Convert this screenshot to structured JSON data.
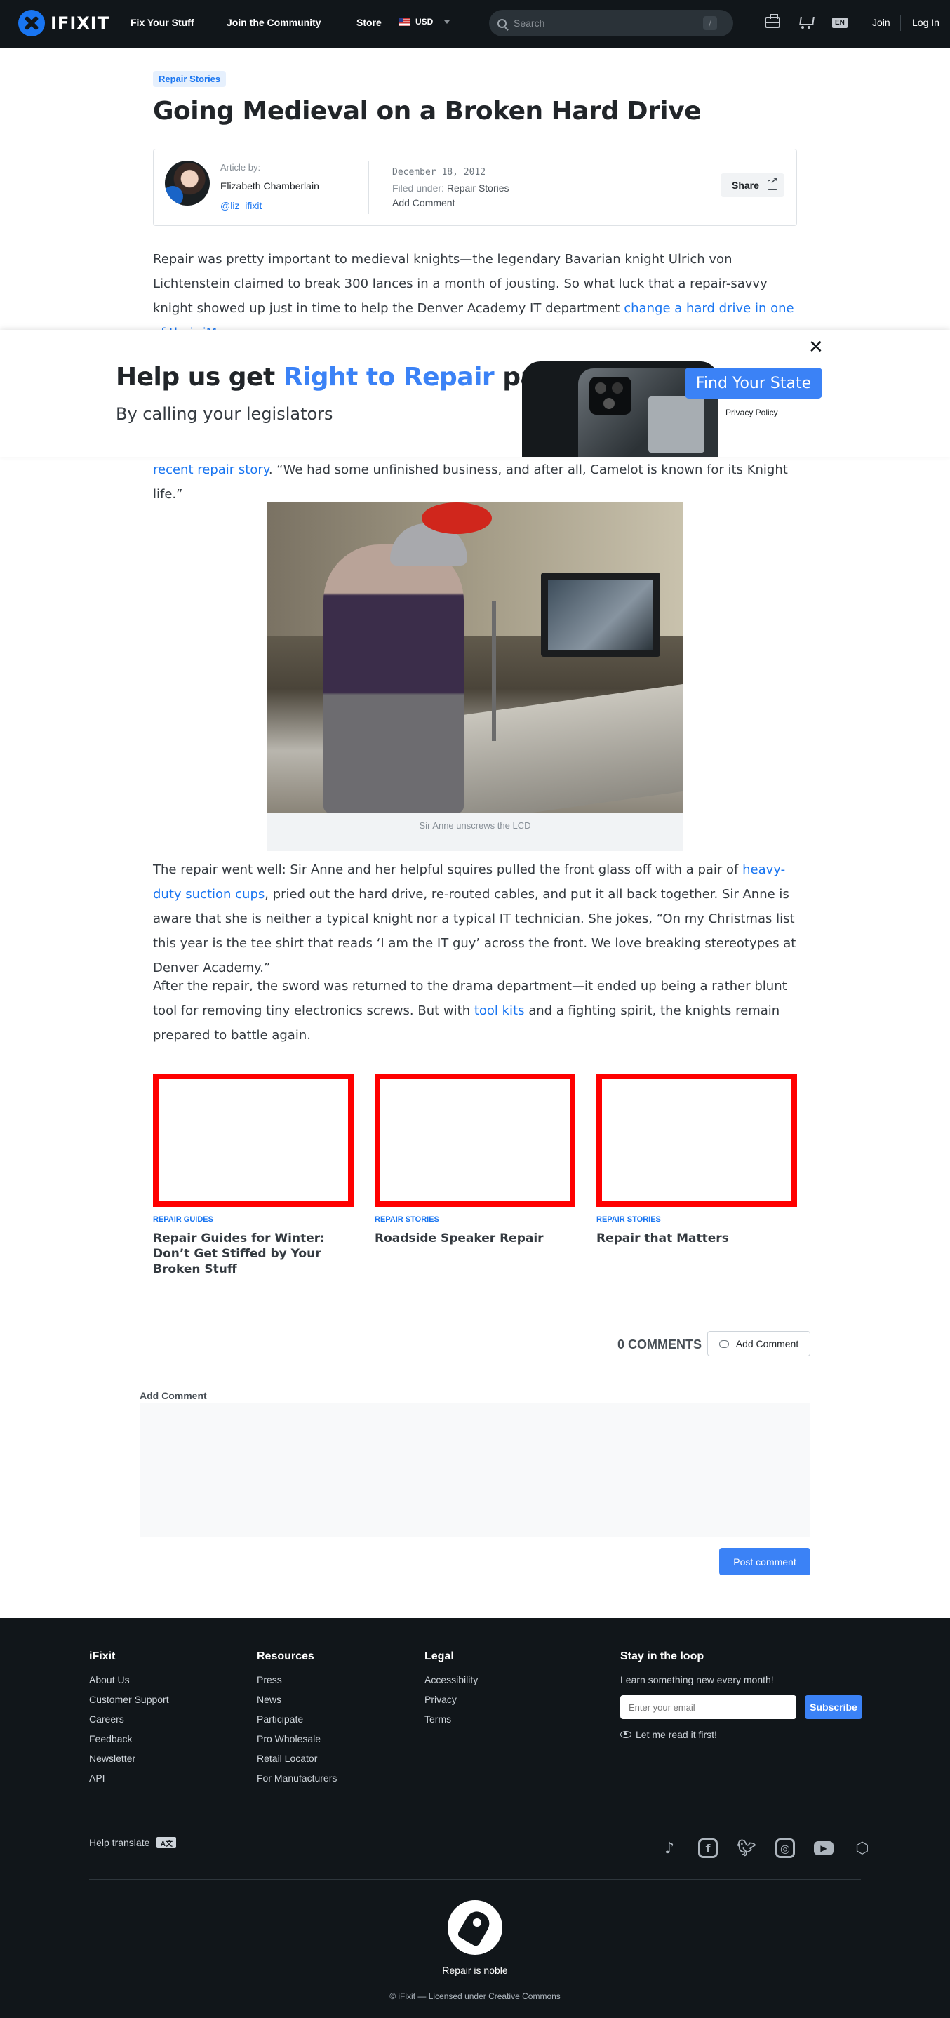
{
  "nav": {
    "logo_text": "IFIXIT",
    "links": [
      "Fix Your Stuff",
      "Join the Community",
      "Store"
    ],
    "currency": "USD",
    "search_placeholder": "Search",
    "search_shortcut": "/",
    "lang": "EN",
    "join": "Join",
    "login": "Log In"
  },
  "article": {
    "tag": "Repair Stories",
    "title": "Going Medieval on a Broken Hard Drive",
    "byline": {
      "label": "Article by:",
      "author": "Elizabeth Chamberlain",
      "handle": "@liz_ifixit",
      "date": "December 18, 2012",
      "filed_prefix": "Filed under:",
      "filed_value": "Repair Stories",
      "add_comment": "Add Comment",
      "share": "Share"
    },
    "p1_text": "Repair was pretty important to medieval knights—the legendary Bavarian knight Ulrich von Lichtenstein claimed to break 300 lances in a month of jousting. So what luck that a repair-savvy knight showed up just in time to help the Denver Academy IT department ",
    "p1_link": "change a hard drive in one of their iMacs",
    "p1_end": ".",
    "p2_link": "recent repair story",
    "p2_text": ". “We had some unfinished business, and after all, Camelot is known for its Knight life.”",
    "caption": "Sir Anne unscrews the LCD",
    "p3_text_a": "The repair went well: Sir Anne and her helpful squires pulled the front glass off with a pair of ",
    "p3_link": "heavy-duty suction cups",
    "p3_text_b": ", pried out the hard drive, re-routed cables, and put it all back together. Sir Anne is aware that she is neither a typical knight nor a typical IT technician. She jokes, “On my Christmas list this year is the tee shirt that reads ‘I am the IT guy’ across the front. We love breaking stereotypes at Denver Academy.”",
    "p4_text_a": "After the repair, the sword was returned to the drama department—it ended up being a rather blunt tool for removing tiny electronics screws. But with ",
    "p4_link": "tool kits",
    "p4_text_b": " and a fighting spirit, the knights remain prepared to battle again."
  },
  "banner": {
    "headline_a": "Help us get ",
    "headline_hl": "Right to Repair",
    "headline_b": " passed",
    "subhead": "By calling your legislators",
    "cta": "Find Your State",
    "privacy": "Privacy Policy",
    "close": "✕"
  },
  "related": [
    {
      "category": "REPAIR GUIDES",
      "title": "Repair Guides for Winter: Don’t Get Stiffed by Your Broken Stuff"
    },
    {
      "category": "REPAIR STORIES",
      "title": "Roadside Speaker Repair"
    },
    {
      "category": "REPAIR STORIES",
      "title": "Repair that Matters"
    }
  ],
  "comments": {
    "count": "0 COMMENTS",
    "add_button": "Add Comment",
    "form_label": "Add Comment",
    "post": "Post comment"
  },
  "footer": {
    "columns": [
      {
        "head": "iFixit",
        "items": [
          "About Us",
          "Customer Support",
          "Careers",
          "Feedback",
          "Newsletter",
          "API"
        ]
      },
      {
        "head": "Resources",
        "items": [
          "Press",
          "News",
          "Participate",
          "Pro Wholesale",
          "Retail Locator",
          "For Manufacturers"
        ]
      },
      {
        "head": "Legal",
        "items": [
          "Accessibility",
          "Privacy",
          "Terms"
        ]
      }
    ],
    "stay": {
      "head": "Stay in the loop",
      "text": "Learn something new every month!",
      "email_placeholder": "Enter your email",
      "subscribe": "Subscribe",
      "read_first": "Let me read it first!"
    },
    "help_translate": "Help translate",
    "socials": [
      "tiktok-icon",
      "facebook-icon",
      "twitter-icon",
      "instagram-icon",
      "youtube-icon",
      "hive-icon"
    ],
    "tagline": "Repair is noble",
    "license": "© iFixit — Licensed under Creative Commons"
  }
}
